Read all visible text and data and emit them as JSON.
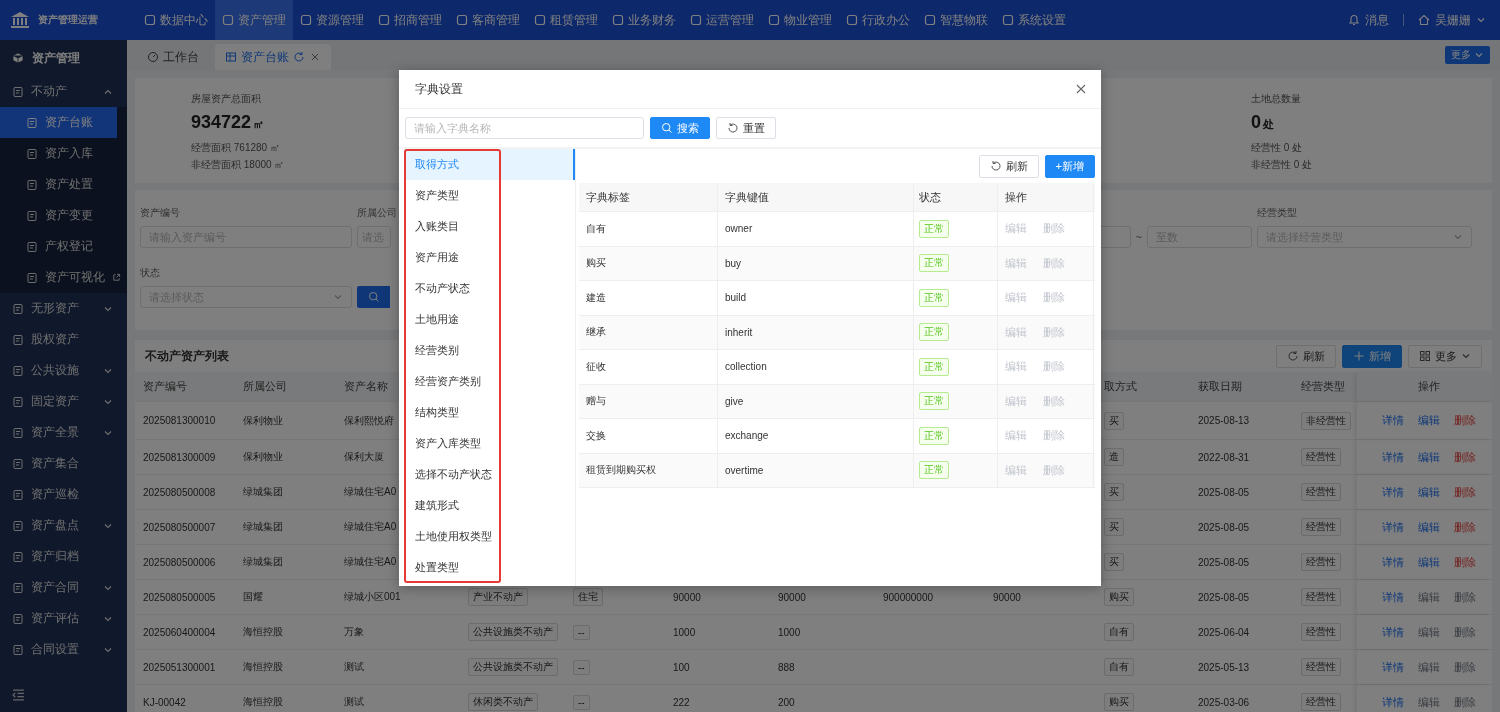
{
  "topbar": {
    "app_title": "资产管理运营",
    "menu": [
      {
        "label": "数据中心",
        "selected": false
      },
      {
        "label": "资产管理",
        "selected": true
      },
      {
        "label": "资源管理",
        "selected": false
      },
      {
        "label": "招商管理",
        "selected": false
      },
      {
        "label": "客商管理",
        "selected": false
      },
      {
        "label": "租赁管理",
        "selected": false
      },
      {
        "label": "业务财务",
        "selected": false
      },
      {
        "label": "运营管理",
        "selected": false
      },
      {
        "label": "物业管理",
        "selected": false
      },
      {
        "label": "行政办公",
        "selected": false
      },
      {
        "label": "智慧物联",
        "selected": false
      },
      {
        "label": "系统设置",
        "selected": false
      }
    ],
    "message": "消息",
    "user": "吴姗姗"
  },
  "sidebar": {
    "heading": "资产管理",
    "items": [
      {
        "label": "不动产",
        "kind": "group",
        "expanded": true,
        "children": [
          {
            "label": "资产台账",
            "kind": "page",
            "selected": true
          },
          {
            "label": "资产入库",
            "kind": "page",
            "selected": false
          },
          {
            "label": "资产处置",
            "kind": "page",
            "selected": false
          },
          {
            "label": "资产变更",
            "kind": "page",
            "selected": false
          },
          {
            "label": "产权登记",
            "kind": "page",
            "selected": false
          },
          {
            "label": "资产可视化",
            "kind": "external",
            "selected": false
          }
        ]
      },
      {
        "label": "无形资产",
        "kind": "group",
        "expanded": false
      },
      {
        "label": "股权资产",
        "kind": "link"
      },
      {
        "label": "公共设施",
        "kind": "group",
        "expanded": false
      },
      {
        "label": "固定资产",
        "kind": "group",
        "expanded": false
      },
      {
        "label": "资产全景",
        "kind": "group",
        "expanded": false
      },
      {
        "label": "资产集合",
        "kind": "link"
      },
      {
        "label": "资产巡检",
        "kind": "link"
      },
      {
        "label": "资产盘点",
        "kind": "group",
        "expanded": false
      },
      {
        "label": "资产归档",
        "kind": "link"
      },
      {
        "label": "资产合同",
        "kind": "group",
        "expanded": false
      },
      {
        "label": "资产评估",
        "kind": "group",
        "expanded": false
      },
      {
        "label": "合同设置",
        "kind": "group",
        "expanded": false
      }
    ]
  },
  "tabs": [
    {
      "label": "工作台",
      "selected": false
    },
    {
      "label": "资产台账",
      "selected": true
    }
  ],
  "more_button": "更多",
  "stats": [
    {
      "label": "房屋资产总面积",
      "value": "934722",
      "unit": "㎡",
      "lines": [
        "经营面积 761280 ㎡",
        "非经营面积 18000 ㎡"
      ]
    },
    {
      "label": "土地总数量",
      "value": "0",
      "unit": "处",
      "lines": [
        "经营性 0 处",
        "非经营性 0 处"
      ]
    }
  ],
  "filters": {
    "asset_no": {
      "label": "资产编号",
      "placeholder": "请输入资产编号"
    },
    "company": {
      "label": "所属公司",
      "placeholder": "请选"
    },
    "range": {
      "separator": "~",
      "placeholder": "至数"
    },
    "biz_type": {
      "label": "经营类型",
      "placeholder": "请选择经营类型"
    },
    "status": {
      "label": "状态",
      "placeholder": "请选择状态"
    }
  },
  "list": {
    "title": "不动产资产列表",
    "refresh": "刷新",
    "add": "新增",
    "more": "更多",
    "columns": [
      "资产编号",
      "所属公司",
      "资产名称",
      null,
      null,
      null,
      null,
      null,
      null,
      "取方式",
      "获取日期",
      "经营类型"
    ],
    "action_column": "操作",
    "rows": [
      {
        "cells": [
          "2025081300010",
          "保利物业",
          "保利熙悦府",
          null,
          null,
          null,
          null,
          null,
          null,
          "买",
          "2025-08-13",
          "非经营性"
        ],
        "actions": [
          "详情",
          "编辑",
          "删除"
        ],
        "editable": true
      },
      {
        "cells": [
          "2025081300009",
          "保利物业",
          "保利大厦",
          null,
          null,
          null,
          null,
          null,
          null,
          "造",
          "2022-08-31",
          "经营性"
        ],
        "actions": [
          "详情",
          "编辑",
          "删除"
        ],
        "editable": true
      },
      {
        "cells": [
          "2025080500008",
          "绿城集团",
          "绿城住宅A0",
          null,
          null,
          null,
          null,
          null,
          null,
          "买",
          "2025-08-05",
          "经营性"
        ],
        "actions": [
          "详情",
          "编辑",
          "删除"
        ],
        "editable": true
      },
      {
        "cells": [
          "2025080500007",
          "绿城集团",
          "绿城住宅A0",
          null,
          null,
          null,
          null,
          null,
          null,
          "买",
          "2025-08-05",
          "经营性"
        ],
        "actions": [
          "详情",
          "编辑",
          "删除"
        ],
        "editable": true
      },
      {
        "cells": [
          "2025080500006",
          "绿城集团",
          "绿城住宅A0",
          null,
          null,
          null,
          null,
          null,
          null,
          "买",
          "2025-08-05",
          "经营性"
        ],
        "actions": [
          "详情",
          "编辑",
          "删除"
        ],
        "editable": true
      },
      {
        "cells": [
          "2025080500005",
          "国耀",
          "绿城小区001",
          "产业不动产",
          "住宅",
          "90000",
          "90000",
          "900000000",
          "90000",
          "购买",
          "2025-08-05",
          "经营性"
        ],
        "actions": [
          "详情",
          "编辑",
          "删除"
        ],
        "editable": false
      },
      {
        "cells": [
          "2025060400004",
          "海恒控股",
          "万象",
          "公共设施类不动产",
          "--",
          "1000",
          "1000",
          null,
          null,
          "自有",
          "2025-06-04",
          "经营性"
        ],
        "actions": [
          "详情",
          "编辑",
          "删除"
        ],
        "editable": false
      },
      {
        "cells": [
          "2025051300001",
          "海恒控股",
          "测试",
          "公共设施类不动产",
          "--",
          "100",
          "888",
          null,
          null,
          "自有",
          "2025-05-13",
          "经营性"
        ],
        "actions": [
          "详情",
          "编辑",
          "删除"
        ],
        "editable": false
      },
      {
        "cells": [
          "KJ-00042",
          "海恒控股",
          "测试",
          "休闲类不动产",
          "--",
          "222",
          "200",
          null,
          null,
          "购买",
          "2025-03-06",
          "经营性"
        ],
        "actions": [
          "详情",
          "编辑",
          "删除"
        ],
        "editable": false
      }
    ]
  },
  "dialog": {
    "title": "字典设置",
    "search_placeholder": "请输入字典名称",
    "search": "搜索",
    "reset": "重置",
    "types": [
      {
        "label": "取得方式",
        "selected": true
      },
      {
        "label": "资产类型",
        "selected": false
      },
      {
        "label": "入账类目",
        "selected": false
      },
      {
        "label": "资产用途",
        "selected": false
      },
      {
        "label": "不动产状态",
        "selected": false
      },
      {
        "label": "土地用途",
        "selected": false
      },
      {
        "label": "经营类别",
        "selected": false
      },
      {
        "label": "经营资产类别",
        "selected": false
      },
      {
        "label": "结构类型",
        "selected": false
      },
      {
        "label": "资产入库类型",
        "selected": false
      },
      {
        "label": "选择不动产状态",
        "selected": false
      },
      {
        "label": "建筑形式",
        "selected": false
      },
      {
        "label": "土地使用权类型",
        "selected": false
      },
      {
        "label": "处置类型",
        "selected": false
      }
    ],
    "refresh": "刷新",
    "add": "+新增",
    "columns": [
      "字典标签",
      "字典键值",
      "状态",
      "操作"
    ],
    "rows": [
      {
        "label": "自有",
        "value": "owner",
        "status": "正常",
        "enabled": true,
        "actions": [
          "编辑",
          "删除"
        ],
        "disabled": true
      },
      {
        "label": "购买",
        "value": "buy",
        "status": "正常",
        "enabled": true,
        "actions": [
          "编辑",
          "删除"
        ],
        "disabled": true
      },
      {
        "label": "建造",
        "value": "build",
        "status": "正常",
        "enabled": true,
        "actions": [
          "编辑",
          "删除"
        ],
        "disabled": true
      },
      {
        "label": "继承",
        "value": "inherit",
        "status": "正常",
        "enabled": true,
        "actions": [
          "编辑",
          "删除"
        ],
        "disabled": true
      },
      {
        "label": "征收",
        "value": "collection",
        "status": "正常",
        "enabled": true,
        "actions": [
          "编辑",
          "删除"
        ],
        "disabled": true
      },
      {
        "label": "赠与",
        "value": "give",
        "status": "正常",
        "enabled": true,
        "actions": [
          "编辑",
          "删除"
        ],
        "disabled": true
      },
      {
        "label": "交换",
        "value": "exchange",
        "status": "正常",
        "enabled": true,
        "actions": [
          "编辑",
          "删除"
        ],
        "disabled": true
      },
      {
        "label": "租赁到期购买权",
        "value": "overtime",
        "status": "正常",
        "enabled": true,
        "actions": [
          "编辑",
          "删除"
        ],
        "disabled": true
      }
    ]
  }
}
